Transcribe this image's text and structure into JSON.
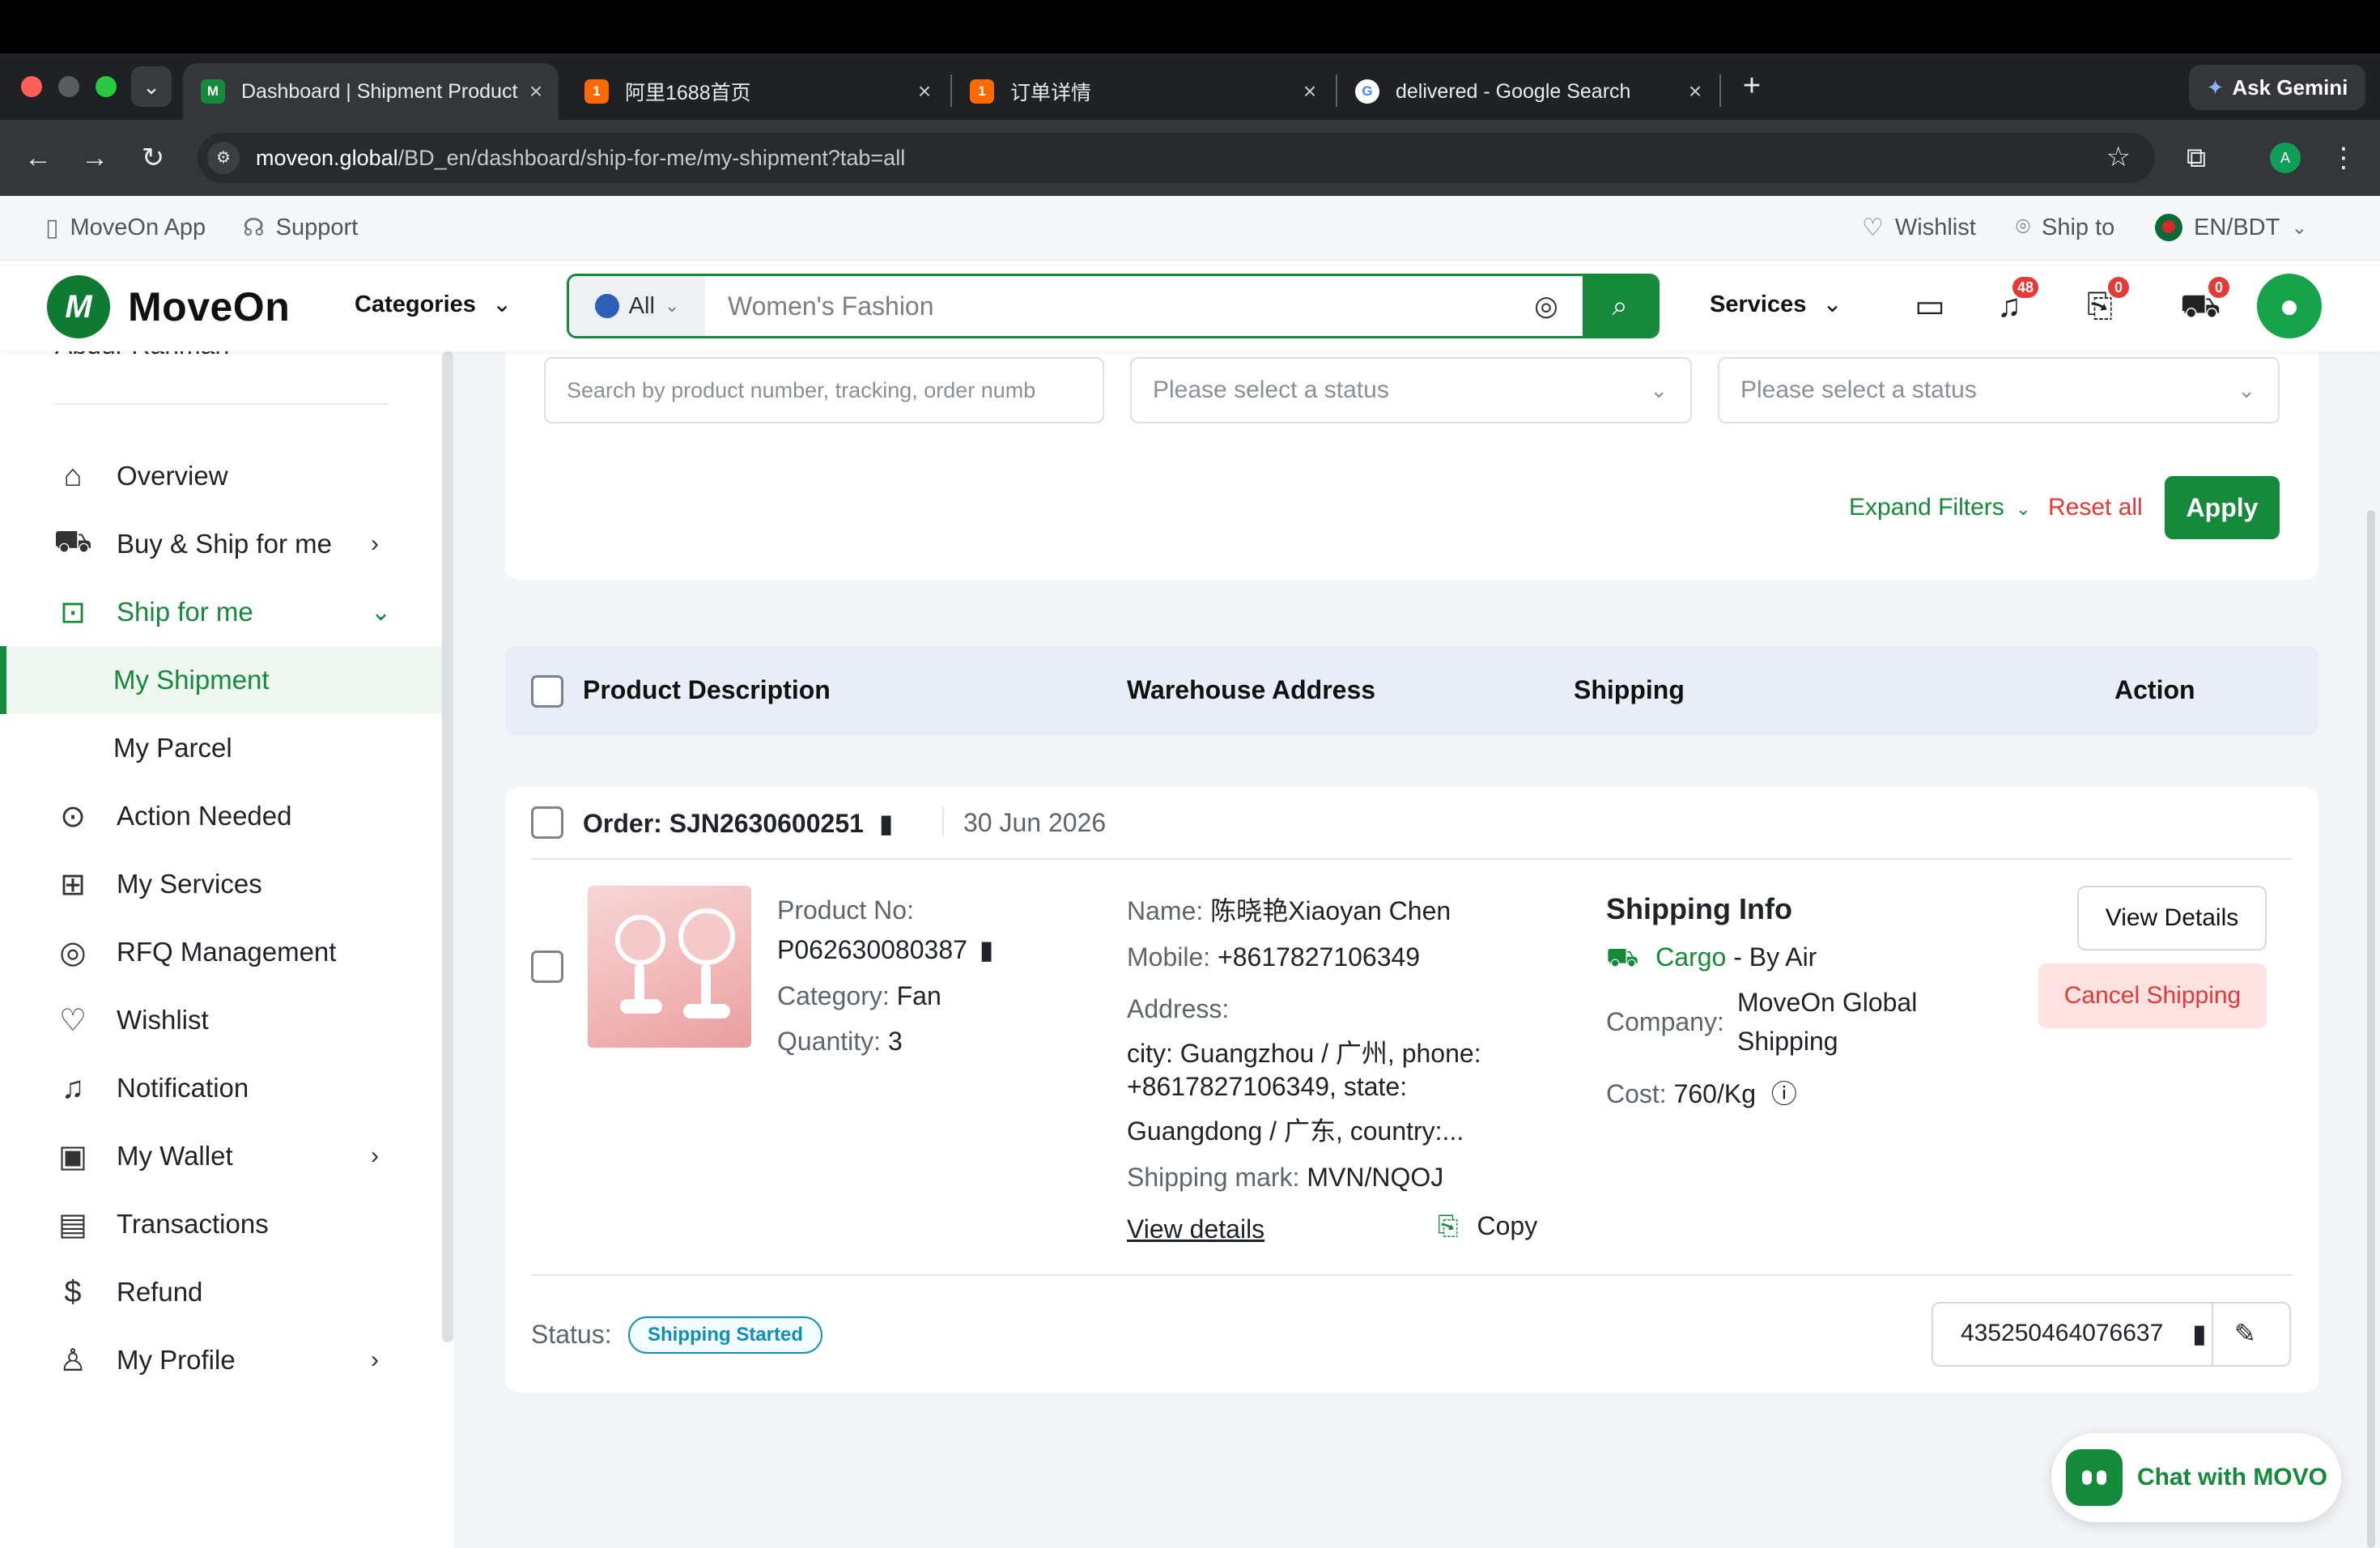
{
  "browser": {
    "tabs": [
      {
        "title": "Dashboard | Shipment Product",
        "active": true
      },
      {
        "title": "阿里1688首页",
        "active": false
      },
      {
        "title": "订单详情",
        "active": false
      },
      {
        "title": "delivered - Google Search",
        "active": false
      }
    ],
    "ask_gemini": "Ask Gemini",
    "url_host": "moveon.global",
    "url_path": "/BD_en/dashboard/ship-for-me/my-shipment?tab=all",
    "profile_initial": "A"
  },
  "utility_bar": {
    "app": "MoveOn App",
    "support": "Support",
    "wishlist": "Wishlist",
    "ship_to": "Ship to",
    "locale": "EN/BDT"
  },
  "header": {
    "brand": "MoveOn",
    "categories": "Categories",
    "search_scope": "All",
    "search_placeholder": "Women's Fashion",
    "services": "Services",
    "notifications_count": "48",
    "rfq_count": "0",
    "cart_count": "0"
  },
  "sidebar": {
    "user_name": "Abdur Rahman",
    "items": [
      {
        "label": "Overview"
      },
      {
        "label": "Buy & Ship for me"
      },
      {
        "label": "Ship for me"
      },
      {
        "label": "My Shipment"
      },
      {
        "label": "My Parcel"
      },
      {
        "label": "Action Needed"
      },
      {
        "label": "My Services"
      },
      {
        "label": "RFQ Management"
      },
      {
        "label": "Wishlist"
      },
      {
        "label": "Notification"
      },
      {
        "label": "My Wallet"
      },
      {
        "label": "Transactions"
      },
      {
        "label": "Refund"
      },
      {
        "label": "My Profile"
      }
    ]
  },
  "filters": {
    "search_placeholder": "Search by product number, tracking, order numb",
    "status_placeholder_1": "Please select a status",
    "status_placeholder_2": "Please select a status",
    "expand": "Expand Filters",
    "reset": "Reset all",
    "apply": "Apply"
  },
  "table": {
    "columns": [
      "Product Description",
      "Warehouse Address",
      "Shipping",
      "Action"
    ]
  },
  "order": {
    "order_label": "Order: SJN2630600251",
    "date": "30 Jun 2026",
    "product_no_label": "Product No:",
    "product_no": "P062630080387",
    "category_label": "Category:",
    "category": "Fan",
    "quantity_label": "Quantity:",
    "quantity": "3",
    "name_label": "Name:",
    "name": "陈晓艳Xiaoyan Chen",
    "mobile_label": "Mobile:",
    "mobile": "+8617827106349",
    "address_label": "Address:",
    "address_line1": "city: Guangzhou / 广州, phone:",
    "address_line2": "+8617827106349, state:",
    "address_line3": "Guangdong / 广东, country:...",
    "shipping_mark_label": "Shipping mark:",
    "shipping_mark": "MVN/NQOJ",
    "view_details_link": "View details",
    "copy": "Copy",
    "shipping_info_title": "Shipping Info",
    "shipping_type": "Cargo",
    "shipping_mode": "- By Air",
    "company_label": "Company:",
    "company_line1": "MoveOn Global",
    "company_line2": "Shipping",
    "cost_label": "Cost:",
    "cost": "760/Kg",
    "view_details_btn": "View Details",
    "cancel_btn": "Cancel Shipping",
    "status_label": "Status:",
    "status": "Shipping Started",
    "tracking": "435250464076637"
  },
  "chat": {
    "label": "Chat with MOVO"
  },
  "colors": {
    "brand_green": "#168a3b",
    "danger": "#e53935",
    "status_blue": "#0f8fb5"
  }
}
